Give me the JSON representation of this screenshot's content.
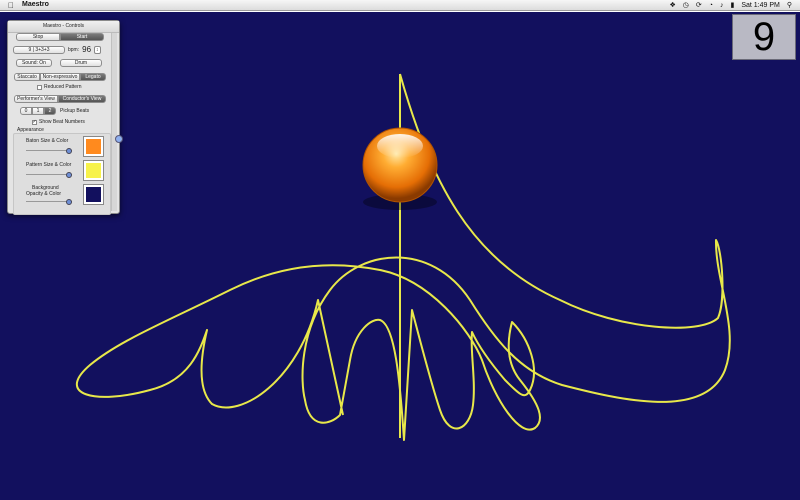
{
  "menubar": {
    "app": "Maestro",
    "datetime": "Sat 1:49 PM"
  },
  "beat": "9",
  "panel": {
    "title": "Maestro - Controls",
    "stop": "Stop",
    "start": "Start",
    "meter": "9 | 3+3+3",
    "bpm_label": "bpm:",
    "bpm_value": "96",
    "sound": "Sound: On",
    "instrument": "Drum",
    "styles": [
      "Staccato",
      "Non-espressivo",
      "Legato"
    ],
    "reduced_pattern": "Reduced Pattern",
    "views": [
      "Performer's View",
      "Conductor's View"
    ],
    "pickup_options": [
      "0",
      "1",
      "2"
    ],
    "pickup_label": "Pickup Beats",
    "show_beat_numbers": "Show Beat Numbers",
    "appearance": "Appearance",
    "baton_label": "Baton Size & Color",
    "pattern_label": "Pattern Size & Color",
    "background_label1": "Background",
    "background_label2": "Opacity & Color",
    "baton_color": "#ff8a1e",
    "pattern_color": "#f7f24a",
    "background_color": "#12105e"
  },
  "canvas": {
    "background": "#12105e",
    "pattern_color": "#e8e84a",
    "baton_color": "#f07a10"
  }
}
